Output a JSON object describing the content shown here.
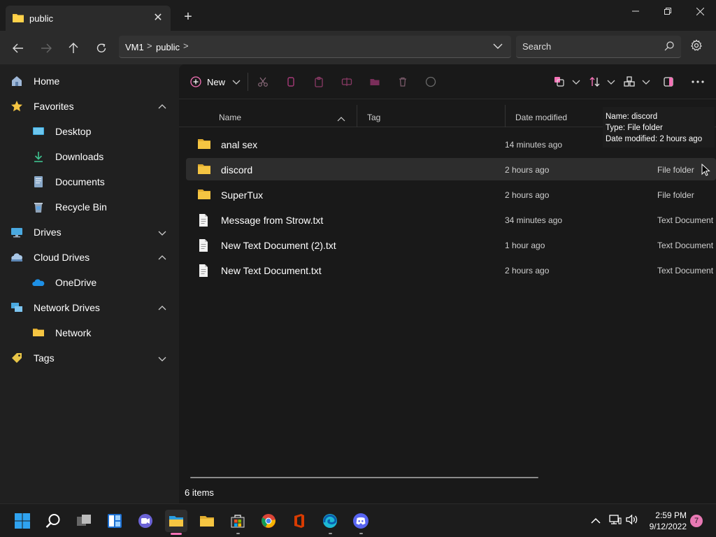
{
  "window": {
    "tab_title": "public",
    "tab_close": "✕",
    "new_tab": "+"
  },
  "address": {
    "breadcrumbs": [
      "VM1",
      "public"
    ],
    "separator": ">",
    "search_placeholder": "Search"
  },
  "sidebar": {
    "items": [
      {
        "label": "Home",
        "icon": "home-icon"
      },
      {
        "label": "Favorites",
        "icon": "star-icon",
        "chevron": "up"
      },
      {
        "label": "Desktop",
        "icon": "desktop-icon"
      },
      {
        "label": "Downloads",
        "icon": "download-icon"
      },
      {
        "label": "Documents",
        "icon": "documents-icon"
      },
      {
        "label": "Recycle Bin",
        "icon": "recycle-bin-icon"
      },
      {
        "label": "Drives",
        "icon": "drive-icon",
        "chevron": "down"
      },
      {
        "label": "Cloud Drives",
        "icon": "cloud-drive-icon",
        "chevron": "up"
      },
      {
        "label": "OneDrive",
        "icon": "onedrive-icon"
      },
      {
        "label": "Network Drives",
        "icon": "network-drive-icon",
        "chevron": "up"
      },
      {
        "label": "Network",
        "icon": "folder-icon"
      },
      {
        "label": "Tags",
        "icon": "tag-icon",
        "chevron": "down"
      }
    ]
  },
  "toolbar": {
    "new_label": "New"
  },
  "columns": {
    "name": "Name",
    "tag": "Tag",
    "date_modified": "Date modified"
  },
  "files": [
    {
      "name": "anal sex",
      "date": "14 minutes ago",
      "type": "",
      "kind": "folder"
    },
    {
      "name": "discord",
      "date": "2 hours ago",
      "type": "File folder",
      "kind": "folder"
    },
    {
      "name": "SuperTux",
      "date": "2 hours ago",
      "type": "File folder",
      "kind": "folder"
    },
    {
      "name": "Message from Strow.txt",
      "date": "34 minutes ago",
      "type": "Text Document",
      "kind": "file"
    },
    {
      "name": "New Text Document (2).txt",
      "date": "1 hour ago",
      "type": "Text Document",
      "kind": "file"
    },
    {
      "name": "New Text Document.txt",
      "date": "2 hours ago",
      "type": "Text Document",
      "kind": "file"
    }
  ],
  "tooltip": {
    "line1": "Name: discord",
    "line2": "Type: File folder",
    "line3": "Date modified: 2 hours ago"
  },
  "status": {
    "item_count": "6 items"
  },
  "taskbar": {
    "time": "2:59 PM",
    "date": "9/12/2022",
    "notification_count": "7"
  },
  "colors": {
    "accent": "#f472b6",
    "folder": "#f5c542",
    "background": "#202020"
  }
}
